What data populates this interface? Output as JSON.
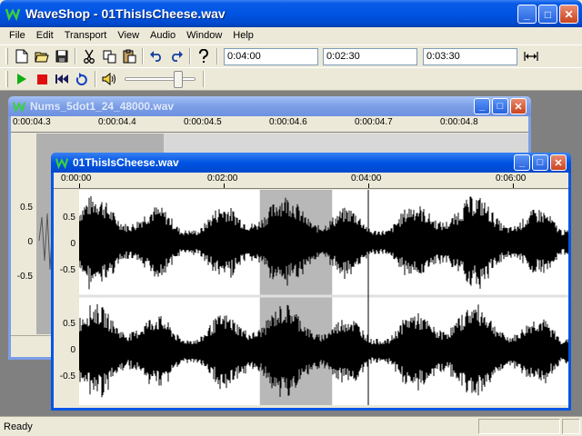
{
  "app": {
    "title": "WaveShop - 01ThisIsCheese.wav"
  },
  "menu": [
    "File",
    "Edit",
    "Transport",
    "View",
    "Audio",
    "Window",
    "Help"
  ],
  "toolbar": {
    "fields": [
      "0:04:00",
      "0:02:30",
      "0:03:30"
    ],
    "volume": 0.78
  },
  "windows": {
    "back": {
      "title": "Nums_5dot1_24_48000.wav",
      "ruler": [
        "0:00:04.3",
        "0:00:04.4",
        "0:00:04.5",
        "0:00:04.6",
        "0:00:04.7",
        "0:00:04.8"
      ],
      "y_labels": [
        "0.5",
        "0",
        "-0.5"
      ]
    },
    "front": {
      "title": "01ThisIsCheese.wav",
      "ruler": [
        "0:00:00",
        "0:02:00",
        "0:04:00",
        "0:06:00"
      ],
      "y_labels": [
        "0.5",
        "0",
        "-0.5"
      ],
      "selection": {
        "start": "0:02:30",
        "end": "0:03:30"
      },
      "cursor": "0:04:00",
      "duration_seconds": 410
    }
  },
  "status": {
    "text": "Ready"
  },
  "colors": {
    "titlebar": "#0054e3",
    "selection": "#b8b8b8",
    "waveform": "#000000"
  }
}
